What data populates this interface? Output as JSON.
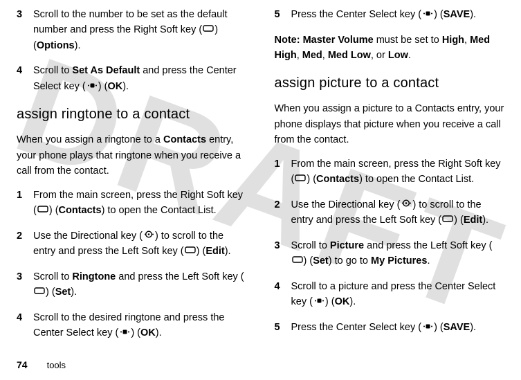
{
  "watermark": "DRAFT",
  "footer": {
    "page": "74",
    "section": "tools"
  },
  "left": {
    "step3": {
      "num": "3",
      "t1": "Scroll to the number to be set as the default number and press the Right Soft key (",
      "t2": ") (",
      "options": "Options",
      "t3": ")."
    },
    "step4a": {
      "num": "4",
      "t1": "Scroll to ",
      "setdefault": "Set As Default",
      "t2": " and press the Center Select key (",
      "t3": ") (",
      "ok": "OK",
      "t4": ")."
    },
    "h_ringtone": "assign ringtone to a contact",
    "intro_a": "When you assign a ringtone to a ",
    "contacts_b": "Contacts",
    "intro_b": " entry, your phone plays that ringtone when you receive a call from the contact.",
    "r1": {
      "num": "1",
      "t1": "From the main screen, press the Right Soft key (",
      "t2": ") (",
      "contacts": "Contacts",
      "t3": ") to open the Contact List."
    },
    "r2": {
      "num": "2",
      "t1": "Use the Directional key (",
      "t2": ") to scroll to the entry and press the Left Soft key (",
      "t3": ") (",
      "edit": "Edit",
      "t4": ")."
    },
    "r3": {
      "num": "3",
      "t1": "Scroll to ",
      "ringtone": "Ringtone",
      "t2": " and press the Left Soft key (",
      "t3": ") (",
      "set": "Set",
      "t4": ")."
    },
    "r4": {
      "num": "4",
      "t1": "Scroll to the desired ringtone and press the Center Select key (",
      "t2": ") (",
      "ok": "OK",
      "t3": ")."
    }
  },
  "right": {
    "step5": {
      "num": "5",
      "t1": "Press the Center Select key (",
      "t2": ") (",
      "save": "SAVE",
      "t3": ")."
    },
    "note_lbl": "Note:",
    "note_a": " ",
    "mv": "Master Volume",
    "note_b": " must be set to ",
    "high": "High",
    "comma1": ", ",
    "medhigh": "Med High",
    "comma2": ", ",
    "med": "Med",
    "comma3": ", ",
    "medlow": "Med Low",
    "comma4": ", or ",
    "low": "Low",
    "period": ".",
    "h_picture": "assign picture to a contact",
    "pic_intro": "When you assign a picture to a Contacts entry, your phone displays that picture when you receive a call from the contact.",
    "p1": {
      "num": "1",
      "t1": "From the main screen, press the Right Soft key (",
      "t2": ") (",
      "contacts": "Contacts",
      "t3": ") to open the Contact List."
    },
    "p2": {
      "num": "2",
      "t1": "Use the Directional key (",
      "t2": ") to scroll to the entry and press the Left Soft key (",
      "t3": ") (",
      "edit": "Edit",
      "t4": ")."
    },
    "p3": {
      "num": "3",
      "t1": "Scroll to ",
      "picture": "Picture",
      "t2": " and press the Left Soft key (",
      "t3": ") (",
      "set": "Set",
      "t4": ") to go to ",
      "mypics": "My Pictures",
      "t5": "."
    },
    "p4": {
      "num": "4",
      "t1": "Scroll to a picture and press the Center Select key (",
      "t2": ") (",
      "ok": "OK",
      "t3": ")."
    },
    "p5": {
      "num": "5",
      "t1": "Press the Center Select key (",
      "t2": ") (",
      "save": "SAVE",
      "t3": ")."
    }
  }
}
